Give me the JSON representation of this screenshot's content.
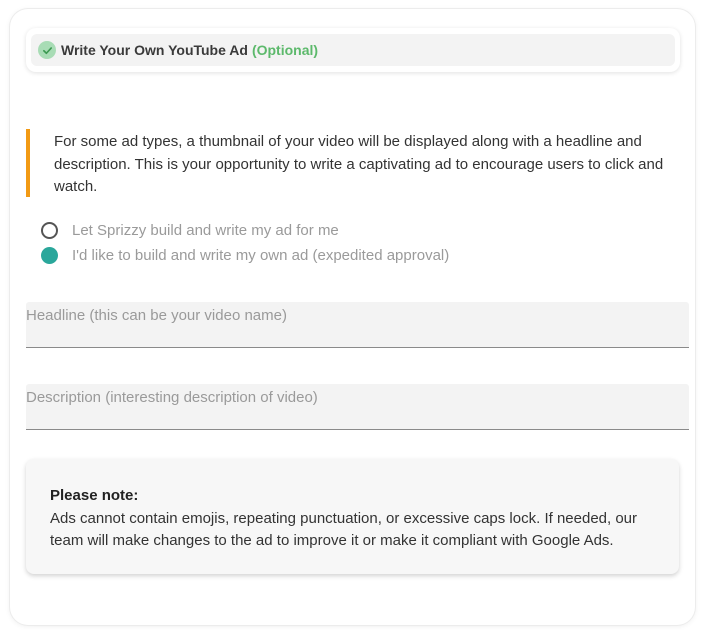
{
  "step": {
    "title": "Write Your Own YouTube Ad",
    "optional": "(Optional)",
    "icon": "check-circle-icon",
    "icon_color": "#a8dcb5",
    "optional_color": "#5cb96b"
  },
  "callout": {
    "text": "For some ad types, a thumbnail of your video will be displayed along with a headline and description. This is your opportunity to write a captivating ad to encourage users to click and watch.",
    "accent_color": "#f29a14"
  },
  "options": [
    {
      "label": "Let Sprizzy build and write my ad for me",
      "selected": false
    },
    {
      "label": "I'd like to build and write my own ad (expedited approval)",
      "selected": true
    }
  ],
  "fields": {
    "headline": {
      "label": "Headline (this can be your video name)",
      "value": ""
    },
    "description": {
      "label": "Description (interesting description of video)",
      "value": ""
    }
  },
  "note": {
    "title": "Please note:",
    "text": "Ads cannot contain emojis, repeating punctuation, or excessive caps lock. If needed, our team will make changes to the ad to improve it or make it compliant with Google Ads."
  },
  "colors": {
    "radio_selected": "#2aa79b"
  }
}
